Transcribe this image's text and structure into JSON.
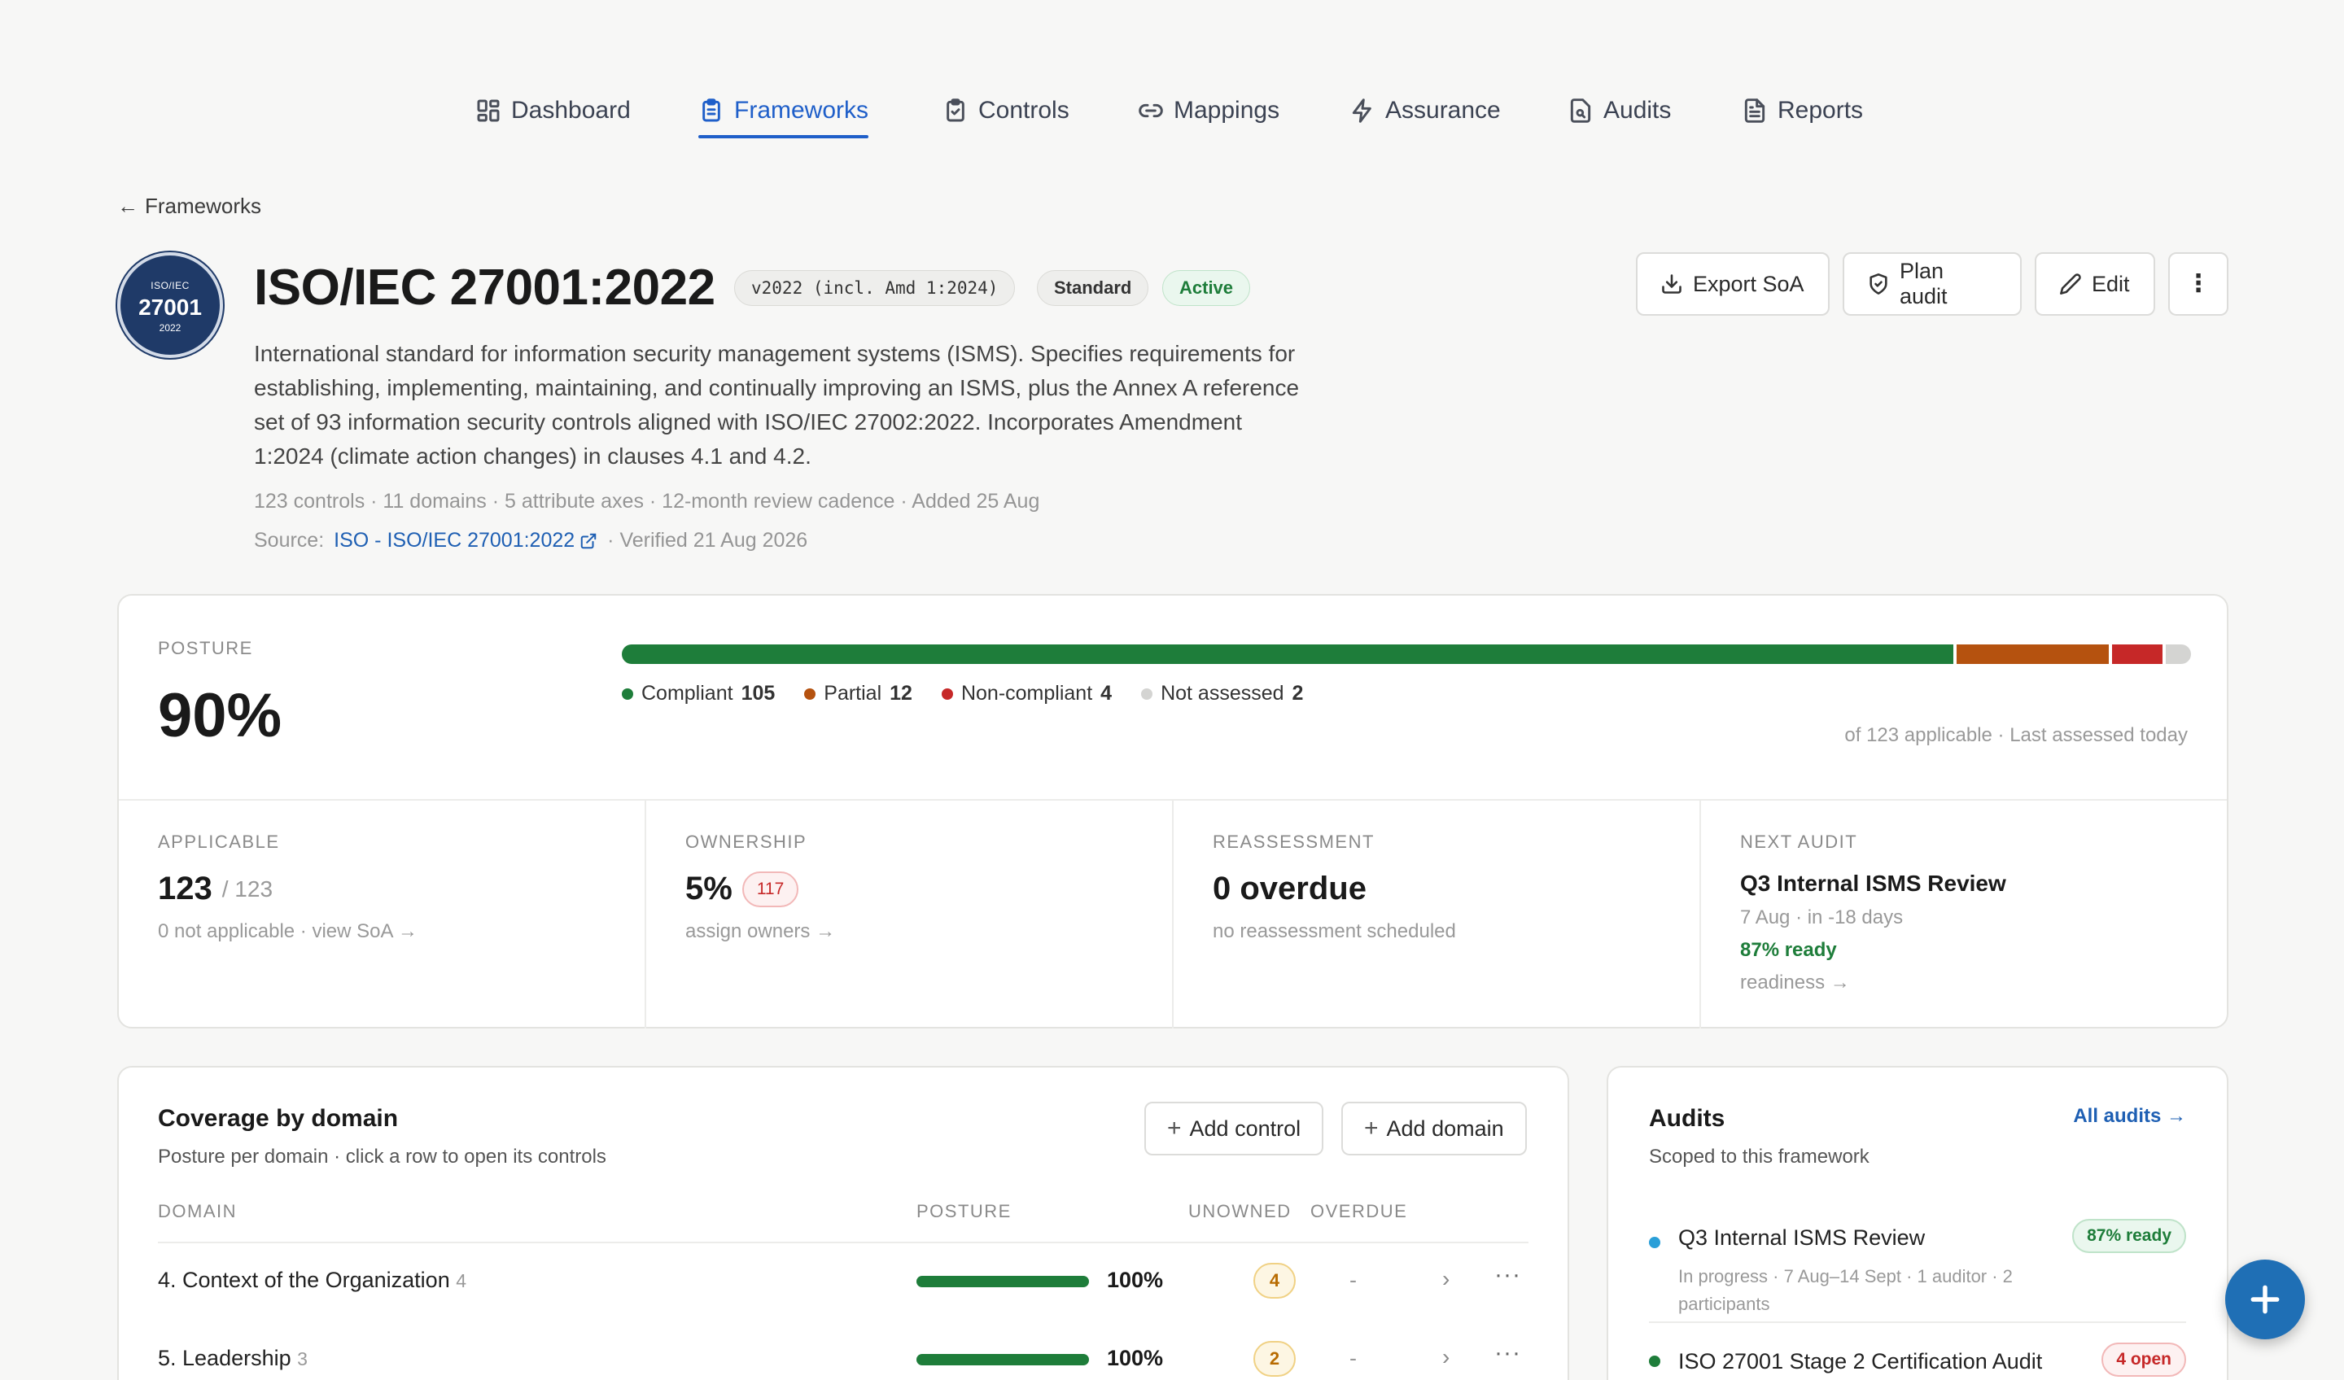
{
  "nav": [
    {
      "label": "Dashboard",
      "icon": "dashboard-icon",
      "active": false
    },
    {
      "label": "Frameworks",
      "icon": "clipboard-list-icon",
      "active": true
    },
    {
      "label": "Controls",
      "icon": "clipboard-check-icon",
      "active": false
    },
    {
      "label": "Mappings",
      "icon": "link-icon",
      "active": false
    },
    {
      "label": "Assurance",
      "icon": "bolt-icon",
      "active": false
    },
    {
      "label": "Audits",
      "icon": "file-search-icon",
      "active": false
    },
    {
      "label": "Reports",
      "icon": "file-text-icon",
      "active": false
    }
  ],
  "back_label": "Frameworks",
  "logo": {
    "line1": "ISO/IEC",
    "line2": "27001",
    "line3": "2022"
  },
  "framework": {
    "title": "ISO/IEC 27001:2022",
    "version": "v2022 (incl. Amd 1:2024)",
    "type": "Standard",
    "status": "Active",
    "description": "International standard for information security management systems (ISMS). Specifies requirements for establishing, implementing, maintaining, and continually improving an ISMS, plus the Annex A reference set of 93 information security controls aligned with ISO/IEC 27002:2022. Incorporates Amendment 1:2024 (climate action changes) in clauses 4.1 and 4.2.",
    "meta": "123 controls · 11 domains · 5 attribute axes · 12-month review cadence · Added 25 Aug",
    "source_label": "Source:",
    "source_link": "ISO - ISO/IEC 27001:2022",
    "verified": "· Verified 21 Aug 2026"
  },
  "actions": {
    "export": "Export SoA",
    "plan": "Plan audit",
    "edit": "Edit"
  },
  "posture": {
    "label": "POSTURE",
    "percent": "90%",
    "assessed": "of 123 applicable · Last assessed today",
    "segments": [
      {
        "name": "Compliant",
        "count": 105,
        "color": "#1e7d3a"
      },
      {
        "name": "Partial",
        "count": 12,
        "color": "#b5520f"
      },
      {
        "name": "Non-compliant",
        "count": 4,
        "color": "#c62828"
      },
      {
        "name": "Not assessed",
        "count": 2,
        "color": "#d4d4d2"
      }
    ],
    "legend": [
      {
        "label": "Compliant",
        "count": "105"
      },
      {
        "label": "Partial",
        "count": "12"
      },
      {
        "label": "Non-compliant",
        "count": "4"
      },
      {
        "label": "Not assessed",
        "count": "2"
      }
    ]
  },
  "stats": {
    "applicable": {
      "label": "APPLICABLE",
      "value": "123",
      "of": "/ 123",
      "sub": "0 not applicable · view SoA →"
    },
    "ownership": {
      "label": "OWNERSHIP",
      "value": "5%",
      "badge": "117",
      "sub": "assign owners →"
    },
    "reassessment": {
      "label": "REASSESSMENT",
      "value": "0 overdue",
      "sub": "no reassessment scheduled"
    },
    "next_audit": {
      "label": "NEXT AUDIT",
      "name": "Q3 Internal ISMS Review",
      "date": "7 Aug · in -18 days",
      "ready": "87% ready",
      "link": "readiness →"
    }
  },
  "coverage": {
    "title": "Coverage by domain",
    "subtitle": "Posture per domain · click a row to open its controls",
    "add_control": "Add control",
    "add_domain": "Add domain",
    "headers": {
      "domain": "DOMAIN",
      "posture": "POSTURE",
      "unowned": "UNOWNED",
      "overdue": "OVERDUE"
    },
    "rows": [
      {
        "name": "4. Context of the Organization",
        "count": "4",
        "posture": "100%",
        "unowned": "4",
        "overdue": "-"
      },
      {
        "name": "5. Leadership",
        "count": "3",
        "posture": "100%",
        "unowned": "2",
        "overdue": "-"
      }
    ]
  },
  "audits": {
    "title": "Audits",
    "subtitle": "Scoped to this framework",
    "all_label": "All audits →",
    "items": [
      {
        "name": "Q3 Internal ISMS Review",
        "detail": "In progress · 7 Aug–14 Sept · 1 auditor · 2 participants",
        "tag": "87% ready",
        "dot_color": "#2a9fd8"
      },
      {
        "name": "ISO 27001 Stage 2 Certification Audit",
        "detail": "",
        "tag": "4 open",
        "dot_color": "#1e7d3a"
      }
    ]
  },
  "colors": {
    "accent": "#1f5fc9",
    "compliant": "#1e7d3a",
    "partial": "#b5520f",
    "noncompliant": "#c62828",
    "fab": "#1f6fb5"
  }
}
